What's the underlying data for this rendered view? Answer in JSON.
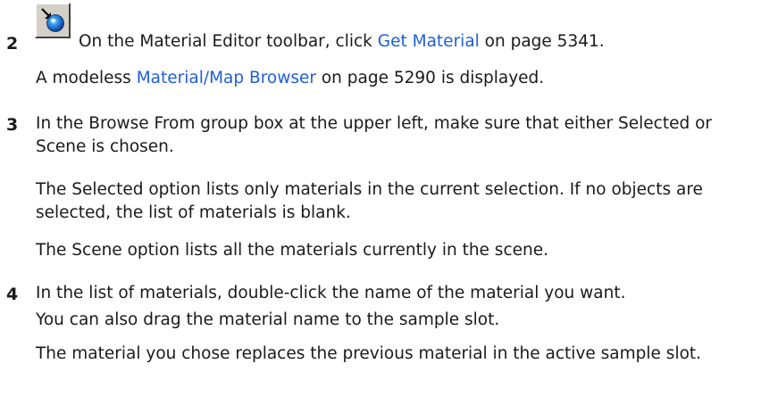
{
  "steps": [
    {
      "number": "2",
      "icon": "get-material-icon",
      "line1": {
        "before": "On the Material Editor toolbar, click ",
        "link": "Get Material",
        "after": " on page 5341."
      },
      "line2": {
        "before": "A modeless ",
        "link": "Material/Map Browser",
        "after": " on page 5290 is displayed."
      }
    },
    {
      "number": "3",
      "text": "In the Browse From group box at the upper left, make sure that either Selected or Scene is chosen.",
      "para2": "The Selected option lists only materials in the current selection. If no objects are selected, the list of materials is blank.",
      "para3": "The Scene option lists all the materials currently in the scene."
    },
    {
      "number": "4",
      "text": "In the list of materials, double-click the name of the material you want.",
      "text2": "You can also drag the material name to the sample slot.",
      "para2": "The material you chose replaces the previous material in the active sample slot."
    }
  ],
  "colors": {
    "link": "#1f5fd6",
    "text": "#1a1a1a",
    "icon_face": "#d4d0c8"
  }
}
